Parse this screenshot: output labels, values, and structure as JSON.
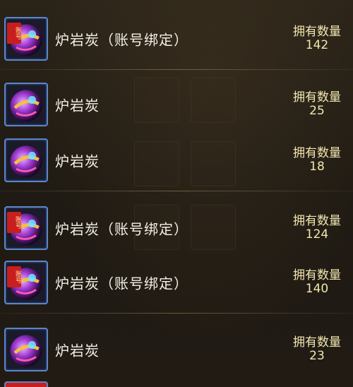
{
  "inventory": {
    "items": [
      {
        "name": "炉岩炭（账号绑定）",
        "count_label": "拥有数量",
        "count": "142",
        "bound": true,
        "bound_tag": "账号"
      },
      {
        "name": "炉岩炭",
        "count_label": "拥有数量",
        "count": "25",
        "bound": false,
        "bound_tag": ""
      },
      {
        "name": "炉岩炭",
        "count_label": "拥有数量",
        "count": "18",
        "bound": false,
        "bound_tag": ""
      },
      {
        "name": "炉岩炭（账号绑定）",
        "count_label": "拥有数量",
        "count": "124",
        "bound": true,
        "bound_tag": "账号"
      },
      {
        "name": "炉岩炭（账号绑定）",
        "count_label": "拥有数量",
        "count": "140",
        "bound": true,
        "bound_tag": "账号"
      },
      {
        "name": "炉岩炭",
        "count_label": "拥有数量",
        "count": "23",
        "bound": false,
        "bound_tag": ""
      }
    ]
  },
  "colors": {
    "background": "#1d1812",
    "text": "#f4f0e6",
    "count_text": "#f2e6b0",
    "icon_border": "#5b86c9",
    "bound_tag": "#c81e1e"
  },
  "icons": {
    "item_icon": "orb-icon",
    "bound_tag": "bound-tag-icon"
  }
}
